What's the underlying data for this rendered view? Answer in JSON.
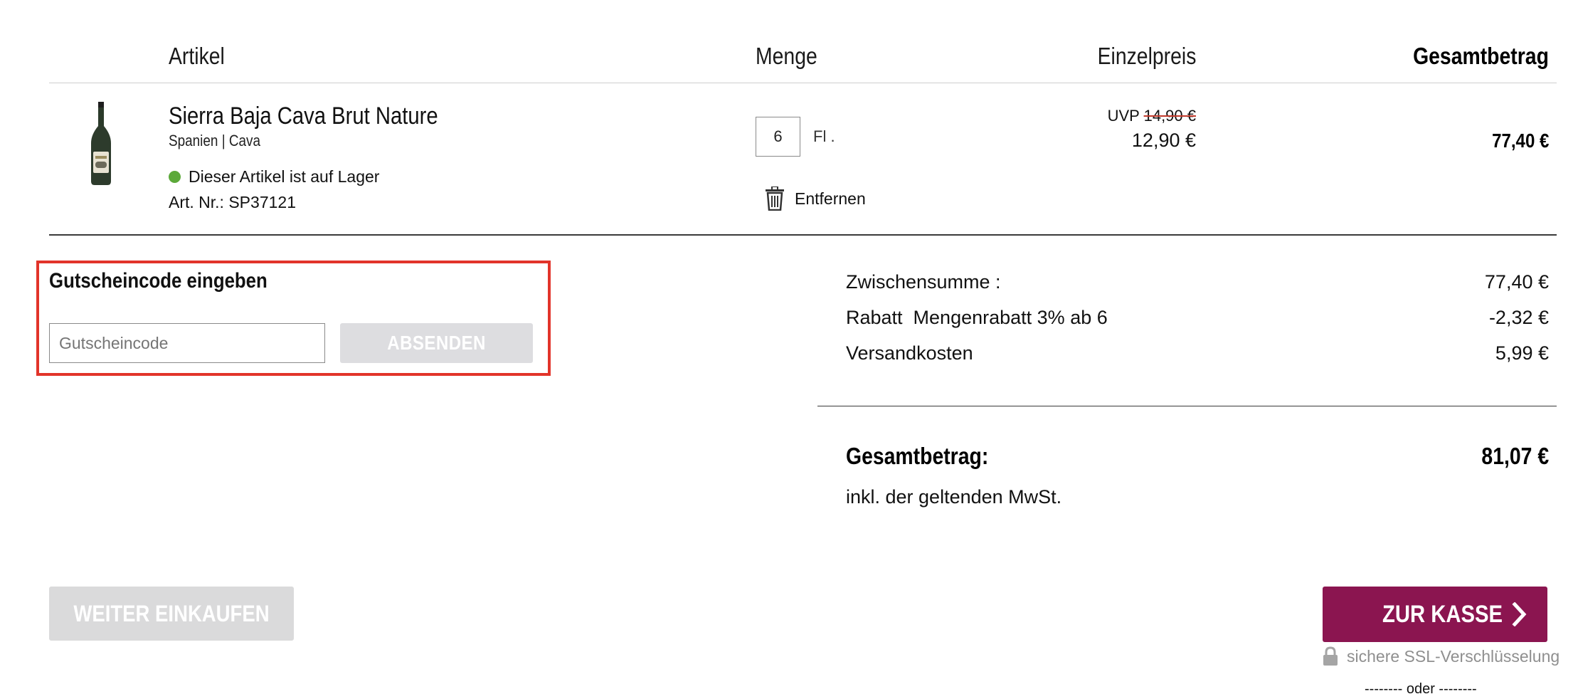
{
  "table_header": {
    "article": "Artikel",
    "quantity": "Menge",
    "unit_price": "Einzelpreis",
    "total": "Gesamtbetrag"
  },
  "item": {
    "name": "Sierra Baja Cava Brut Nature",
    "origin": "Spanien | Cava",
    "stock_status": "Dieser Artikel ist auf Lager",
    "article_number": "Art. Nr.: SP37121",
    "quantity": "6",
    "unit": "Fl .",
    "remove_label": "Entfernen",
    "uvp_label": "UVP",
    "old_price": "14,90 €",
    "price": "12,90 €",
    "line_total": "77,40 €",
    "stock_color": "#5ca93a"
  },
  "coupon": {
    "title": "Gutscheincode eingeben",
    "placeholder": "Gutscheincode",
    "submit_label": "ABSENDEN"
  },
  "summary": {
    "subtotal_label": "Zwischensumme :",
    "subtotal_value": "77,40 €",
    "discount_label": "Rabatt  Mengenrabatt 3% ab 6",
    "discount_value": "-2,32 €",
    "shipping_label": "Versandkosten",
    "shipping_value": "5,99 €",
    "total_label": "Gesamtbetrag:",
    "total_value": "81,07 €",
    "vat_note": "inkl. der geltenden MwSt."
  },
  "actions": {
    "continue_label": "WEITER EINKAUFEN",
    "checkout_label": "ZUR KASSE",
    "ssl_note": "sichere SSL-Verschlüsselung",
    "or_divider": "-------- oder --------"
  },
  "colors": {
    "accent": "#8b1550",
    "highlight_frame": "#e2342a",
    "button_disabled": "#dadadb"
  },
  "icons": {
    "bottle": "wine-bottle-icon",
    "trash": "trash-icon",
    "lock": "lock-icon",
    "chevron": "chevron-right-icon"
  }
}
